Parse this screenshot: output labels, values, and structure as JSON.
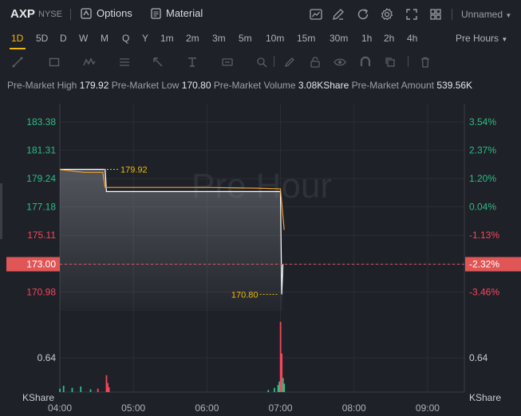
{
  "header": {
    "ticker": "AXP",
    "exchange": "NYSE",
    "options_label": "Options",
    "material_label": "Material",
    "layout_name": "Unnamed"
  },
  "timeframes": [
    "1D",
    "5D",
    "D",
    "W",
    "M",
    "Q",
    "Y",
    "1m",
    "2m",
    "3m",
    "5m",
    "10m",
    "15m",
    "30m",
    "1h",
    "2h",
    "4h"
  ],
  "active_timeframe": "1D",
  "session_label": "Pre Hours",
  "info": {
    "high_label": "Pre-Market High",
    "high_value": "179.92",
    "low_label": "Pre-Market Low",
    "low_value": "170.80",
    "volume_label": "Pre-Market Volume",
    "volume_value": "3.08KShare",
    "amount_label": "Pre-Market Amount",
    "amount_value": "539.56K"
  },
  "watermark": "Pre Hour",
  "colors": {
    "up": "#2ebd85",
    "down": "#f6465d",
    "accent": "#f0b90b",
    "price_line": "#ffffff",
    "avg_line": "#f0a030",
    "current_tag": "#e05656"
  },
  "chart_data": {
    "type": "line",
    "x_ticks": [
      "04:00",
      "05:00",
      "06:00",
      "07:00",
      "08:00",
      "09:00"
    ],
    "x_range": [
      "04:00",
      "09:30"
    ],
    "y_range": [
      169.6,
      184.6
    ],
    "y_ticks_left": [
      "183.38",
      "181.31",
      "179.24",
      "177.18",
      "175.11",
      "173.00",
      "170.98"
    ],
    "y_ticks_right": [
      "3.54%",
      "2.37%",
      "1.20%",
      "0.04%",
      "-1.13%",
      "-2.32%",
      "-3.46%"
    ],
    "y_tick_values": [
      183.38,
      181.31,
      179.24,
      177.18,
      175.11,
      173.0,
      170.98
    ],
    "current_price": "173.00",
    "current_pct": "-2.32%",
    "high_marker": "179.92",
    "low_marker": "170.80",
    "series": [
      {
        "x": [
          "04:00",
          "04:37",
          "04:38",
          "07:00",
          "07:01",
          "07:02"
        ],
        "y": [
          179.92,
          179.92,
          178.3,
          178.3,
          170.8,
          173.0
        ]
      },
      {
        "x": [
          "04:00",
          "04:20",
          "04:35",
          "04:37",
          "05:30",
          "06:00",
          "06:40",
          "07:00",
          "07:03"
        ],
        "y": [
          179.9,
          179.7,
          179.7,
          178.6,
          178.6,
          178.6,
          178.55,
          178.5,
          175.5
        ]
      }
    ],
    "volume_axis_label": "KShare",
    "volume_tick": "0.64",
    "volume_ylim": [
      0,
      1.1
    ],
    "volume_bars": [
      {
        "x": "04:00",
        "v": 0.05,
        "dir": "up"
      },
      {
        "x": "04:03",
        "v": 0.09,
        "dir": "up"
      },
      {
        "x": "04:10",
        "v": 0.06,
        "dir": "up"
      },
      {
        "x": "04:17",
        "v": 0.08,
        "dir": "up"
      },
      {
        "x": "04:25",
        "v": 0.04,
        "dir": "up"
      },
      {
        "x": "04:31",
        "v": 0.05,
        "dir": "down"
      },
      {
        "x": "04:38",
        "v": 0.24,
        "dir": "down"
      },
      {
        "x": "04:39",
        "v": 0.13,
        "dir": "down"
      },
      {
        "x": "04:40",
        "v": 0.07,
        "dir": "down"
      },
      {
        "x": "06:50",
        "v": 0.03,
        "dir": "up"
      },
      {
        "x": "06:55",
        "v": 0.06,
        "dir": "up"
      },
      {
        "x": "06:58",
        "v": 0.1,
        "dir": "up"
      },
      {
        "x": "06:59",
        "v": 0.15,
        "dir": "up"
      },
      {
        "x": "07:00",
        "v": 1.0,
        "dir": "down"
      },
      {
        "x": "07:01",
        "v": 0.55,
        "dir": "down"
      },
      {
        "x": "07:02",
        "v": 0.2,
        "dir": "up"
      },
      {
        "x": "07:03",
        "v": 0.12,
        "dir": "up"
      }
    ]
  }
}
